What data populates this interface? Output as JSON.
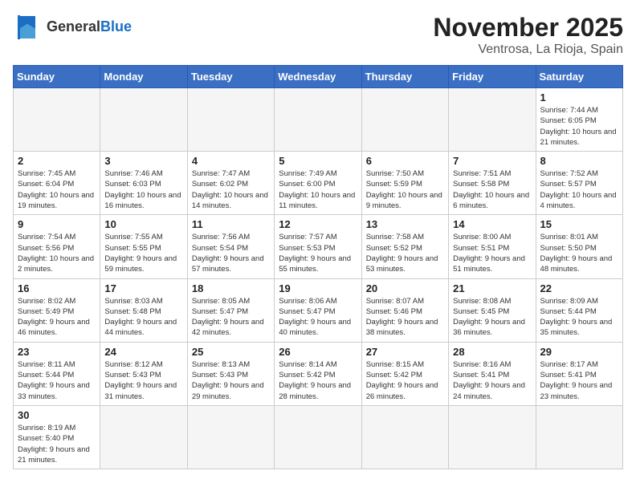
{
  "header": {
    "logo_general": "General",
    "logo_blue": "Blue",
    "title": "November 2025",
    "subtitle": "Ventrosa, La Rioja, Spain"
  },
  "weekdays": [
    "Sunday",
    "Monday",
    "Tuesday",
    "Wednesday",
    "Thursday",
    "Friday",
    "Saturday"
  ],
  "weeks": [
    [
      {
        "day": null,
        "info": null
      },
      {
        "day": null,
        "info": null
      },
      {
        "day": null,
        "info": null
      },
      {
        "day": null,
        "info": null
      },
      {
        "day": null,
        "info": null
      },
      {
        "day": null,
        "info": null
      },
      {
        "day": "1",
        "info": "Sunrise: 7:44 AM\nSunset: 6:05 PM\nDaylight: 10 hours and 21 minutes."
      }
    ],
    [
      {
        "day": "2",
        "info": "Sunrise: 7:45 AM\nSunset: 6:04 PM\nDaylight: 10 hours and 19 minutes."
      },
      {
        "day": "3",
        "info": "Sunrise: 7:46 AM\nSunset: 6:03 PM\nDaylight: 10 hours and 16 minutes."
      },
      {
        "day": "4",
        "info": "Sunrise: 7:47 AM\nSunset: 6:02 PM\nDaylight: 10 hours and 14 minutes."
      },
      {
        "day": "5",
        "info": "Sunrise: 7:49 AM\nSunset: 6:00 PM\nDaylight: 10 hours and 11 minutes."
      },
      {
        "day": "6",
        "info": "Sunrise: 7:50 AM\nSunset: 5:59 PM\nDaylight: 10 hours and 9 minutes."
      },
      {
        "day": "7",
        "info": "Sunrise: 7:51 AM\nSunset: 5:58 PM\nDaylight: 10 hours and 6 minutes."
      },
      {
        "day": "8",
        "info": "Sunrise: 7:52 AM\nSunset: 5:57 PM\nDaylight: 10 hours and 4 minutes."
      }
    ],
    [
      {
        "day": "9",
        "info": "Sunrise: 7:54 AM\nSunset: 5:56 PM\nDaylight: 10 hours and 2 minutes."
      },
      {
        "day": "10",
        "info": "Sunrise: 7:55 AM\nSunset: 5:55 PM\nDaylight: 9 hours and 59 minutes."
      },
      {
        "day": "11",
        "info": "Sunrise: 7:56 AM\nSunset: 5:54 PM\nDaylight: 9 hours and 57 minutes."
      },
      {
        "day": "12",
        "info": "Sunrise: 7:57 AM\nSunset: 5:53 PM\nDaylight: 9 hours and 55 minutes."
      },
      {
        "day": "13",
        "info": "Sunrise: 7:58 AM\nSunset: 5:52 PM\nDaylight: 9 hours and 53 minutes."
      },
      {
        "day": "14",
        "info": "Sunrise: 8:00 AM\nSunset: 5:51 PM\nDaylight: 9 hours and 51 minutes."
      },
      {
        "day": "15",
        "info": "Sunrise: 8:01 AM\nSunset: 5:50 PM\nDaylight: 9 hours and 48 minutes."
      }
    ],
    [
      {
        "day": "16",
        "info": "Sunrise: 8:02 AM\nSunset: 5:49 PM\nDaylight: 9 hours and 46 minutes."
      },
      {
        "day": "17",
        "info": "Sunrise: 8:03 AM\nSunset: 5:48 PM\nDaylight: 9 hours and 44 minutes."
      },
      {
        "day": "18",
        "info": "Sunrise: 8:05 AM\nSunset: 5:47 PM\nDaylight: 9 hours and 42 minutes."
      },
      {
        "day": "19",
        "info": "Sunrise: 8:06 AM\nSunset: 5:47 PM\nDaylight: 9 hours and 40 minutes."
      },
      {
        "day": "20",
        "info": "Sunrise: 8:07 AM\nSunset: 5:46 PM\nDaylight: 9 hours and 38 minutes."
      },
      {
        "day": "21",
        "info": "Sunrise: 8:08 AM\nSunset: 5:45 PM\nDaylight: 9 hours and 36 minutes."
      },
      {
        "day": "22",
        "info": "Sunrise: 8:09 AM\nSunset: 5:44 PM\nDaylight: 9 hours and 35 minutes."
      }
    ],
    [
      {
        "day": "23",
        "info": "Sunrise: 8:11 AM\nSunset: 5:44 PM\nDaylight: 9 hours and 33 minutes."
      },
      {
        "day": "24",
        "info": "Sunrise: 8:12 AM\nSunset: 5:43 PM\nDaylight: 9 hours and 31 minutes."
      },
      {
        "day": "25",
        "info": "Sunrise: 8:13 AM\nSunset: 5:43 PM\nDaylight: 9 hours and 29 minutes."
      },
      {
        "day": "26",
        "info": "Sunrise: 8:14 AM\nSunset: 5:42 PM\nDaylight: 9 hours and 28 minutes."
      },
      {
        "day": "27",
        "info": "Sunrise: 8:15 AM\nSunset: 5:42 PM\nDaylight: 9 hours and 26 minutes."
      },
      {
        "day": "28",
        "info": "Sunrise: 8:16 AM\nSunset: 5:41 PM\nDaylight: 9 hours and 24 minutes."
      },
      {
        "day": "29",
        "info": "Sunrise: 8:17 AM\nSunset: 5:41 PM\nDaylight: 9 hours and 23 minutes."
      }
    ],
    [
      {
        "day": "30",
        "info": "Sunrise: 8:19 AM\nSunset: 5:40 PM\nDaylight: 9 hours and 21 minutes."
      },
      {
        "day": null,
        "info": null
      },
      {
        "day": null,
        "info": null
      },
      {
        "day": null,
        "info": null
      },
      {
        "day": null,
        "info": null
      },
      {
        "day": null,
        "info": null
      },
      {
        "day": null,
        "info": null
      }
    ]
  ]
}
